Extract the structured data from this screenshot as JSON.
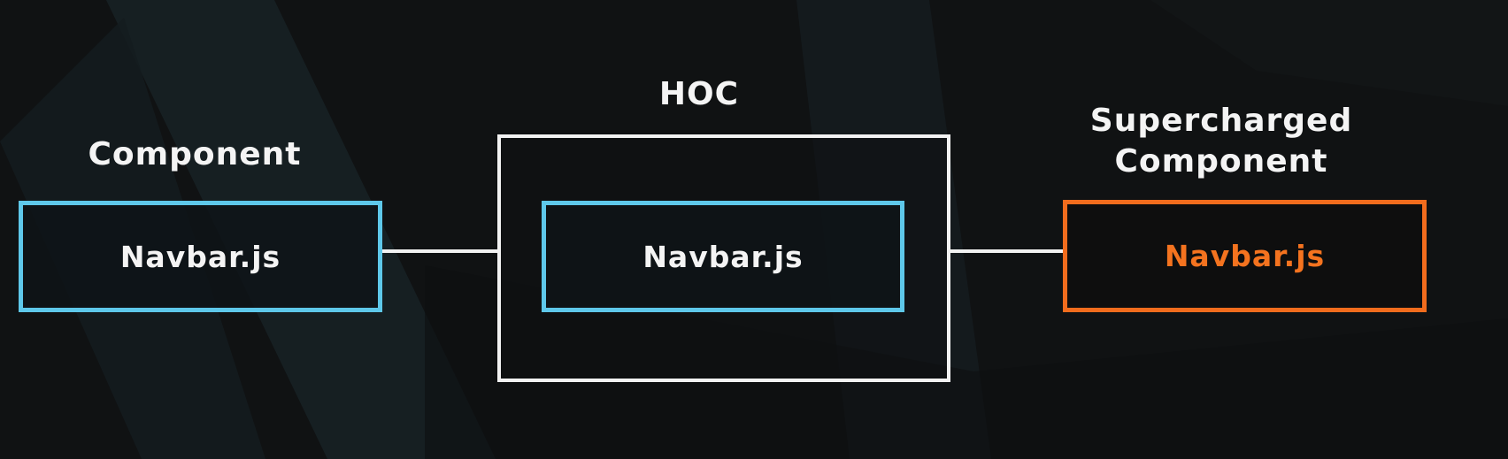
{
  "labels": {
    "component": "Component",
    "hoc": "HOC",
    "supercharged_line1": "Supercharged",
    "supercharged_line2": "Component"
  },
  "boxes": {
    "component": "Navbar.js",
    "wrapped": "Navbar.js",
    "supercharged": "Navbar.js"
  },
  "colors": {
    "background": "#101213",
    "component_border": "#5ec8ea",
    "hoc_border": "#f2f2f2",
    "supercharged_border": "#f26c1d",
    "supercharged_text": "#f4731f",
    "text": "#f4f4f4"
  }
}
